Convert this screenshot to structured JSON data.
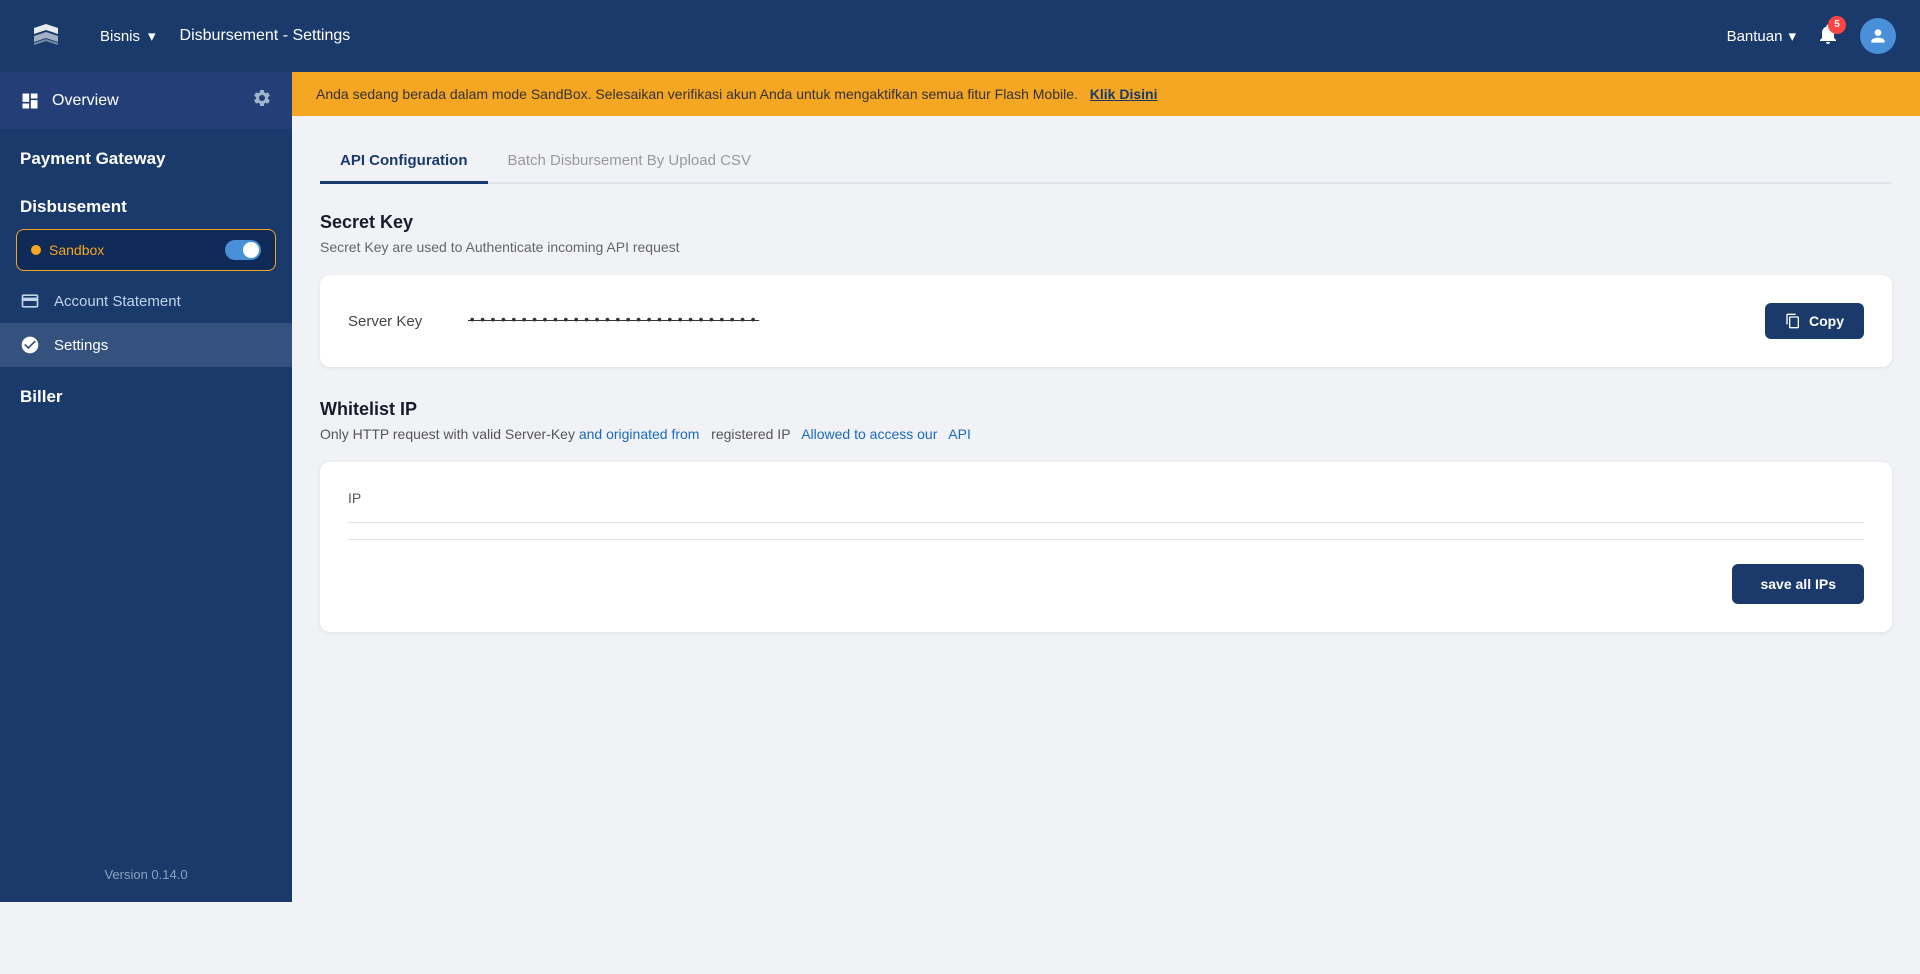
{
  "header": {
    "bisnis_label": "Bisnis",
    "title": "Disbursement - Settings",
    "bantuan_label": "Bantuan",
    "notification_count": "5",
    "chevron": "▾"
  },
  "banner": {
    "text": "Anda sedang berada dalam mode SandBox. Selesaikan verifikasi akun Anda untuk mengaktifkan semua fitur Flash Mobile.",
    "link_text": "Klik Disini"
  },
  "sidebar": {
    "overview_label": "Overview",
    "payment_gateway_label": "Payment Gateway",
    "disbursement_label": "Disbusement",
    "sandbox_label": "Sandbox",
    "account_statement_label": "Account Statement",
    "settings_label": "Settings",
    "biller_label": "Biller",
    "version_label": "Version 0.14.0"
  },
  "tabs": {
    "api_config_label": "API Configuration",
    "batch_disbursement_label": "Batch Disbursement By Upload CSV"
  },
  "secret_key": {
    "title": "Secret Key",
    "description": "Secret Key are used to Authenticate incoming API request",
    "server_key_label": "Server Key",
    "server_key_value": "••••••••••••••••••••••••••••••••",
    "copy_button_label": "Copy"
  },
  "whitelist_ip": {
    "title": "Whitelist IP",
    "description_plain": "Only HTTP request with valid Server-Key",
    "description_blue1": "and originated from",
    "description_plain2": "registered IP",
    "description_blue2": "Allowed to access our",
    "description_blue3": "API",
    "ip_label": "IP",
    "save_button_label": "save all IPs"
  }
}
